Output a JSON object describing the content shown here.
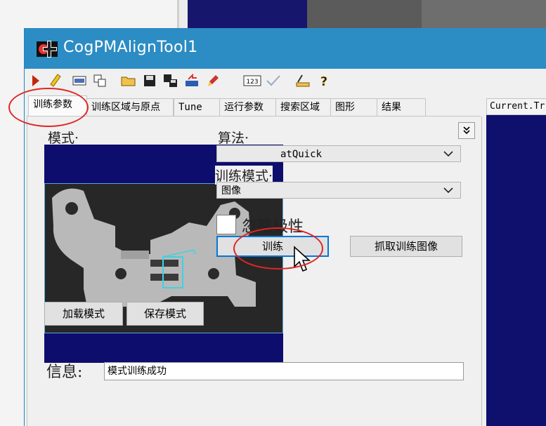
{
  "window": {
    "title": "CogPMAlignTool1"
  },
  "toolbar": {
    "icons": [
      "run-icon",
      "edit-icon",
      "layout-icon",
      "copy-icon",
      "open-folder-icon",
      "save-icon",
      "multi-save-icon",
      "reset-icon",
      "brush-icon",
      "counter-icon",
      "check-icon",
      "ruler-icon",
      "help-icon"
    ],
    "counter_label": "123",
    "help_label": "?"
  },
  "tabs": [
    {
      "label": "训练参数",
      "active": true
    },
    {
      "label": "训练区域与原点",
      "active": false
    },
    {
      "label": "Tune",
      "active": false
    },
    {
      "label": "运行参数",
      "active": false
    },
    {
      "label": "搜索区域",
      "active": false
    },
    {
      "label": "图形",
      "active": false
    },
    {
      "label": "结果",
      "active": false
    }
  ],
  "right_panel": {
    "tab_label": "Current.Tr"
  },
  "panel": {
    "collapse_glyph": "¥",
    "pattern_label": "模式·",
    "algorithm_label": "算法·",
    "algorithm_value": "atQuick",
    "train_mode_label": "训练模式·",
    "train_mode_value": "图像",
    "ignore_polarity_label": "忽略极性",
    "ignore_polarity_checked": false,
    "train_button": "训练",
    "grab_train_image_button": "抓取训练图像",
    "load_pattern_button": "加载模式",
    "save_pattern_button": "保存模式",
    "info_label": "信息:",
    "info_value": "模式训练成功"
  },
  "colors": {
    "titlebar": "#2c8cc4",
    "image_background": "#0d0d6e",
    "annotation": "#e02626",
    "roi": "#3fd2e0"
  }
}
